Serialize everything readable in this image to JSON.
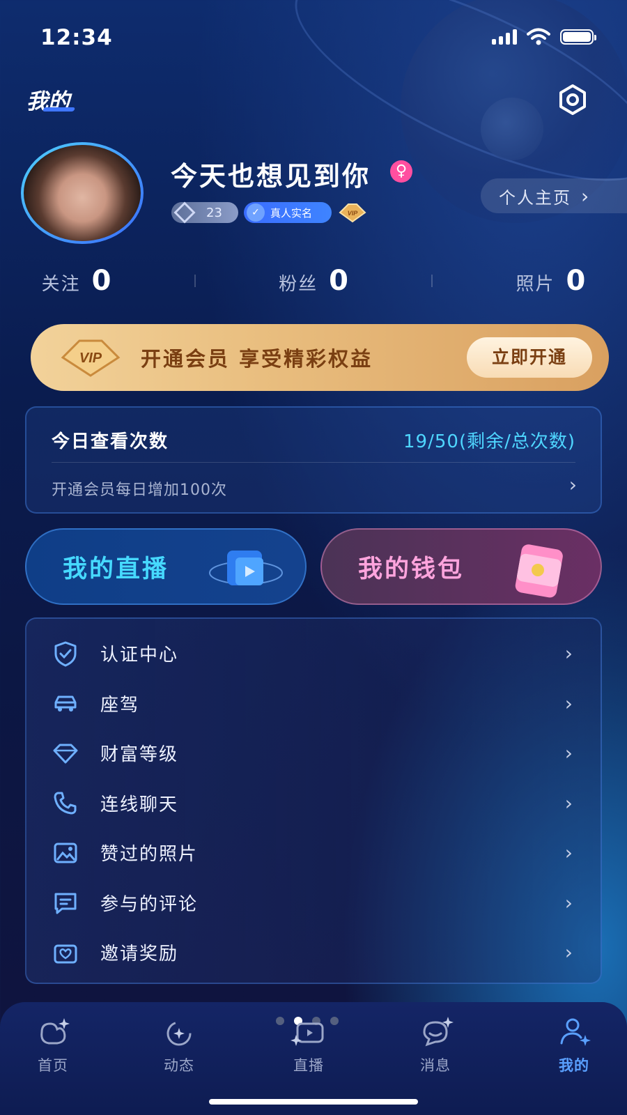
{
  "status_bar": {
    "time": "12:34"
  },
  "header": {
    "title": "我的"
  },
  "profile": {
    "nickname": "今天也想见到你",
    "gender_symbol": "♀",
    "level": "23",
    "verified_label": "真人实名",
    "vip_label": "VIP",
    "homepage_label": "个人主页"
  },
  "stats": [
    {
      "label": "关注",
      "value": "0"
    },
    {
      "label": "粉丝",
      "value": "0"
    },
    {
      "label": "照片",
      "value": "0"
    }
  ],
  "vip_banner": {
    "badge": "VIP",
    "text": "开通会员 享受精彩权益",
    "button": "立即开通"
  },
  "quota": {
    "title": "今日查看次数",
    "value": "19/50(剩余/总次数)",
    "subtitle": "开通会员每日增加100次"
  },
  "quick_actions": {
    "live": "我的直播",
    "wallet": "我的钱包"
  },
  "menu": [
    {
      "label": "认证中心",
      "icon": "shield-check-icon"
    },
    {
      "label": "座驾",
      "icon": "car-icon"
    },
    {
      "label": "财富等级",
      "icon": "diamond-icon"
    },
    {
      "label": "连线聊天",
      "icon": "phone-icon"
    },
    {
      "label": "赞过的照片",
      "icon": "image-icon"
    },
    {
      "label": "参与的评论",
      "icon": "comment-icon"
    },
    {
      "label": "邀请奖励",
      "icon": "gift-icon"
    }
  ],
  "tabs": [
    {
      "label": "首页",
      "icon": "home-icon",
      "active": false
    },
    {
      "label": "动态",
      "icon": "moments-icon",
      "active": false
    },
    {
      "label": "直播",
      "icon": "live-icon",
      "active": false
    },
    {
      "label": "消息",
      "icon": "message-icon",
      "active": false
    },
    {
      "label": "我的",
      "icon": "profile-icon",
      "active": true
    }
  ],
  "colors": {
    "accent": "#4fd6ff",
    "vip_gold": "#e9be7f",
    "active_tab": "#5aa0ff"
  }
}
